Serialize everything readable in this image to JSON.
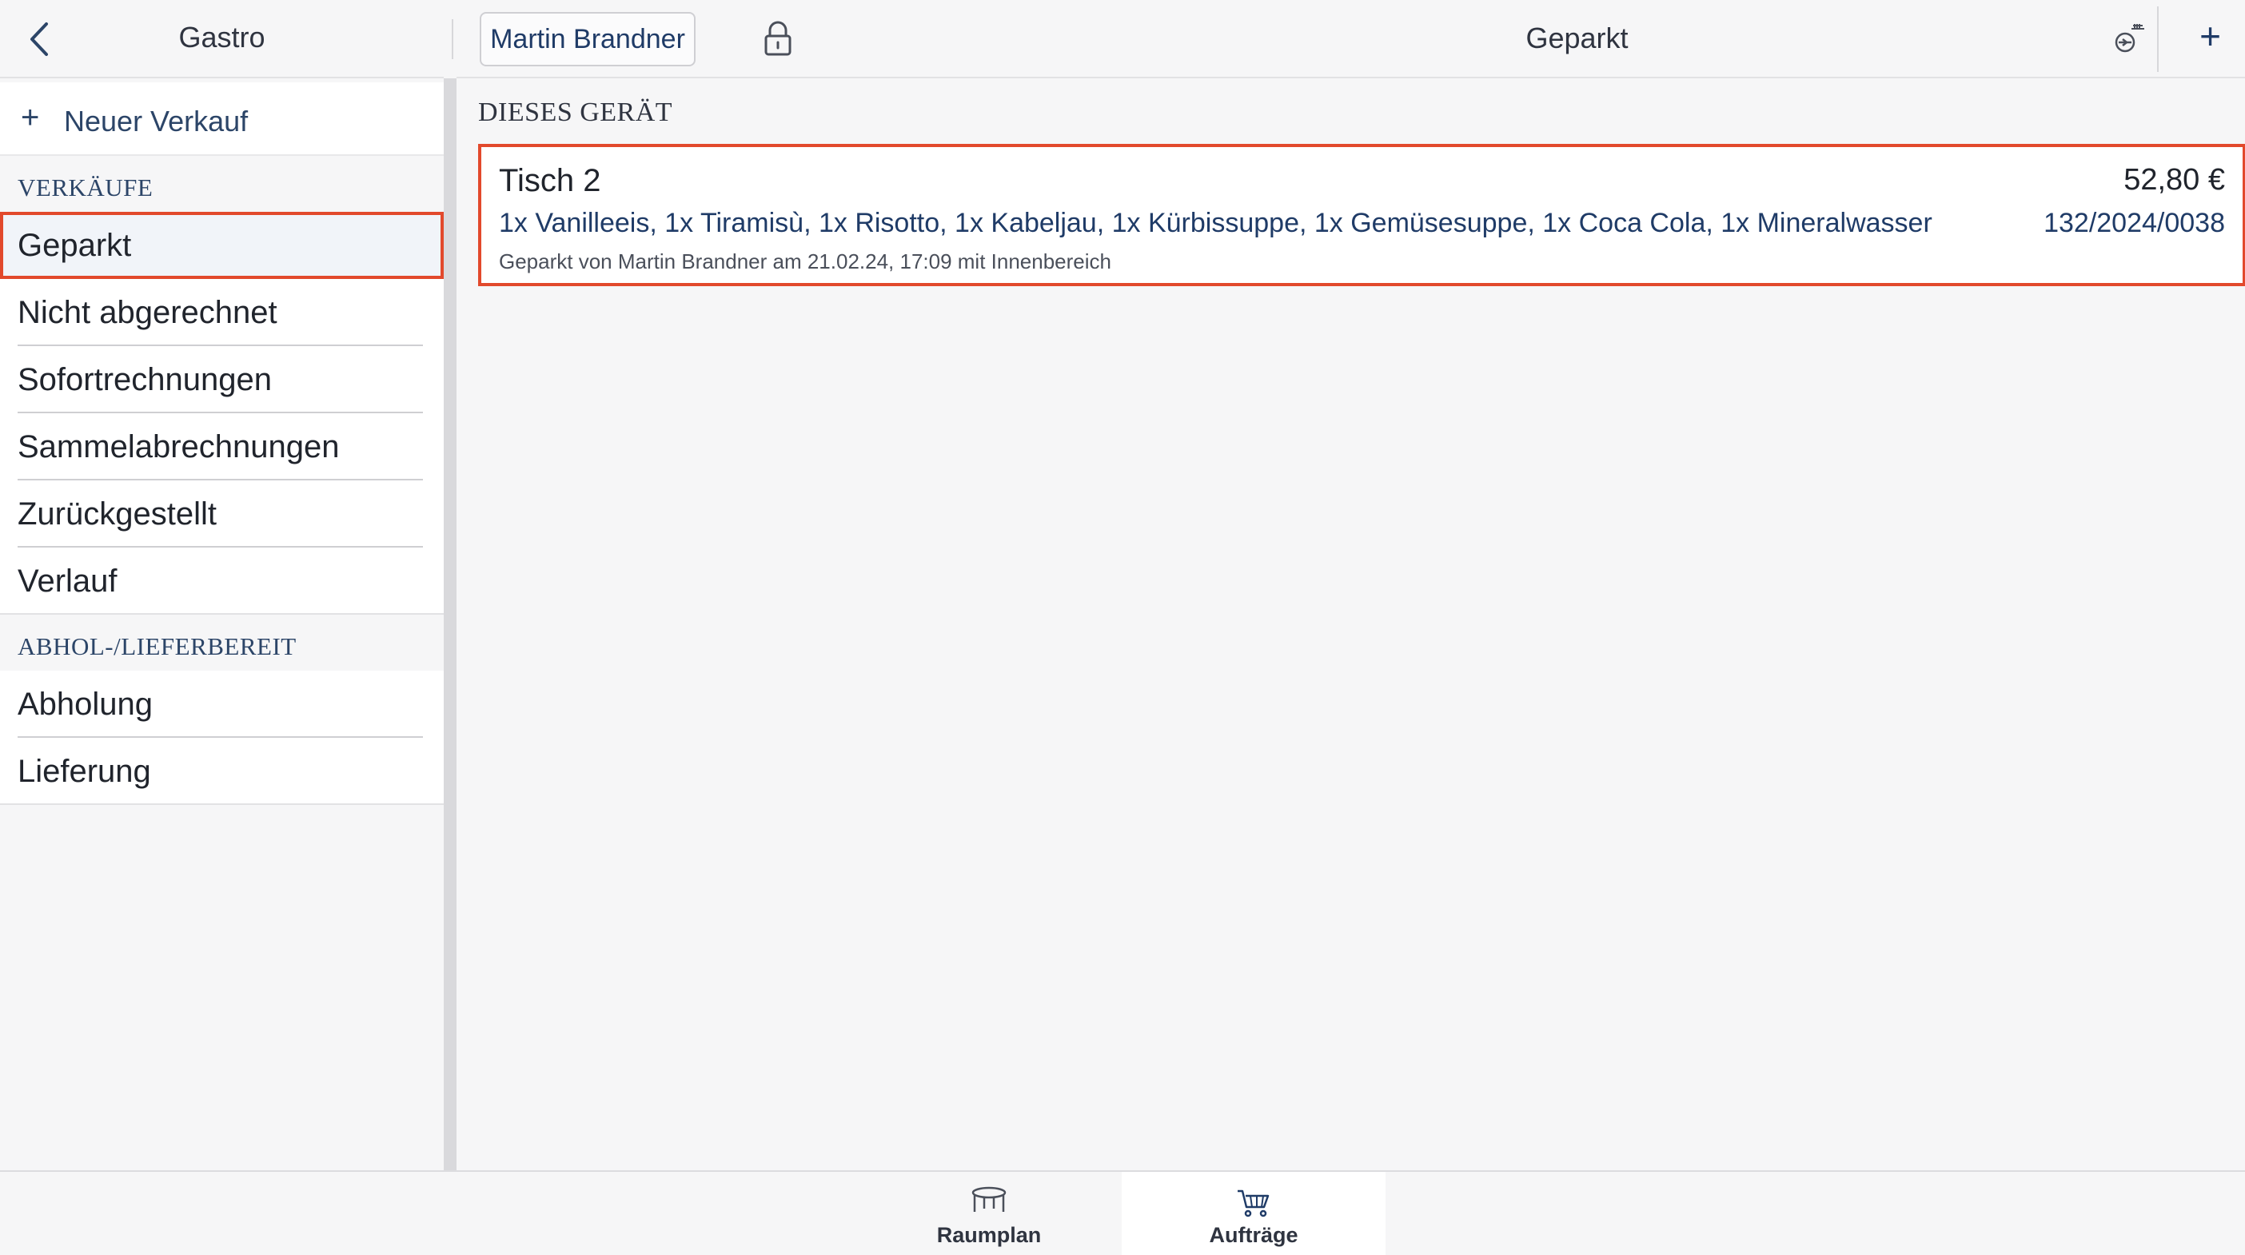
{
  "sidebar": {
    "title": "Gastro",
    "new_sale": "Neuer Verkauf",
    "sections": [
      {
        "heading": "VERKÄUFE",
        "items": [
          "Geparkt",
          "Nicht abgerechnet",
          "Sofortrechnungen",
          "Sammelabrechnungen",
          "Zurückgestellt",
          "Verlauf"
        ]
      },
      {
        "heading": "ABHOL-/LIEFERBEREIT",
        "items": [
          "Abholung",
          "Lieferung"
        ]
      }
    ],
    "active_item": "Geparkt"
  },
  "header": {
    "user": "Martin Brandner",
    "title": "Geparkt"
  },
  "main": {
    "section_heading": "DIESES GERÄT",
    "order": {
      "name": "Tisch 2",
      "items": "1x Vanilleeis, 1x Tiramisù, 1x Risotto, 1x Kabeljau, 1x Kürbissuppe, 1x Gemüsesuppe, 1x Coca Cola, 1x Mineralwasser",
      "meta": "Geparkt von Martin Brandner am 21.02.24, 17:09 mit Innenbereich",
      "amount": "52,80 €",
      "number": "132/2024/0038"
    }
  },
  "tabs": [
    {
      "label": "Raumplan",
      "icon": "table-icon"
    },
    {
      "label": "Aufträge",
      "icon": "basket-icon",
      "active": true
    }
  ],
  "colors": {
    "accent": "#1f3b67",
    "highlight": "#e2492c",
    "background": "#f6f6f7"
  }
}
